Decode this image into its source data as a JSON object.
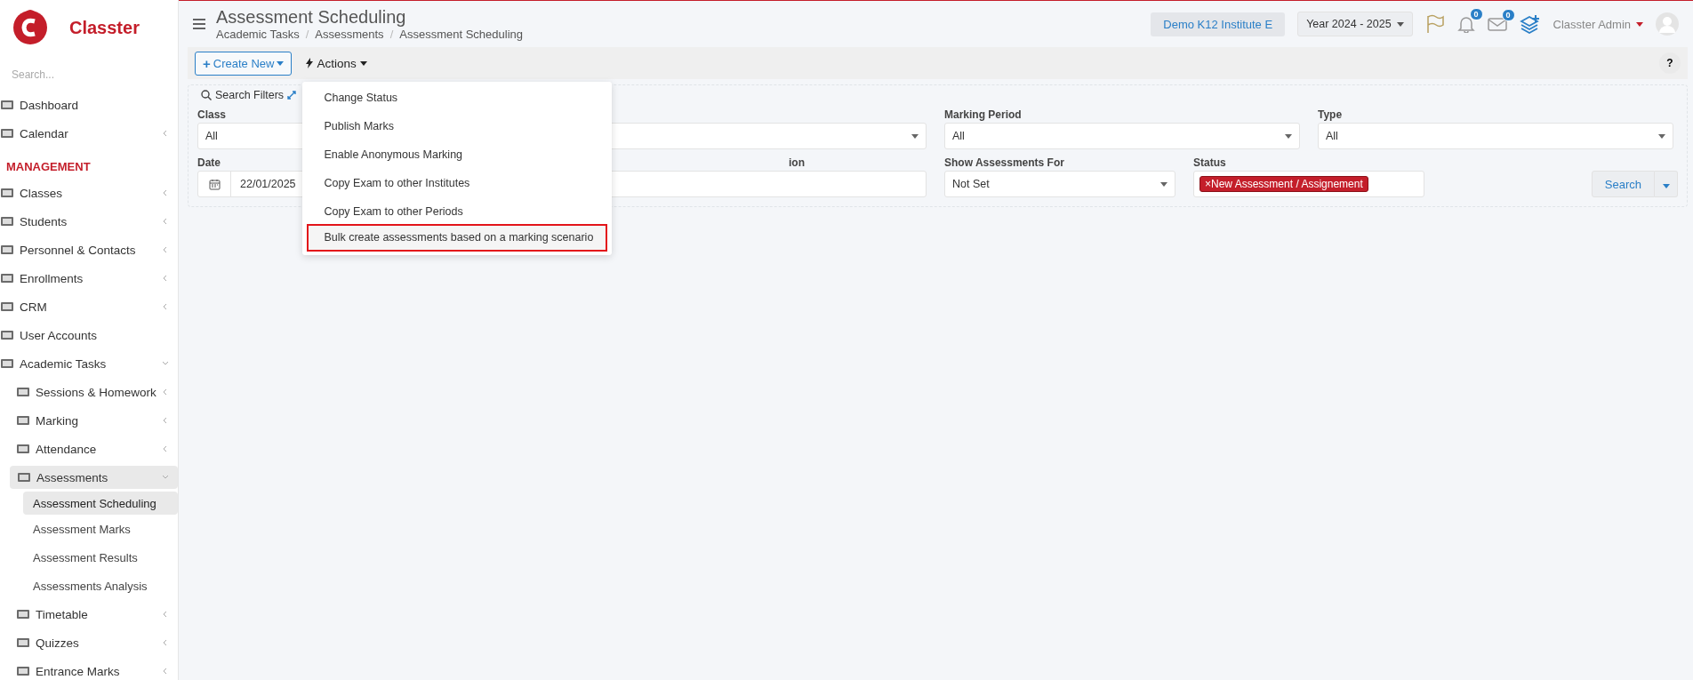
{
  "brand": {
    "name": "Classter"
  },
  "sidebar": {
    "search": {
      "placeholder": "Search..."
    },
    "items": [
      {
        "kind": "link",
        "label": "Dashboard",
        "selected": false
      },
      {
        "kind": "link",
        "label": "Calendar",
        "expanded": false,
        "selected": false
      },
      {
        "kind": "section",
        "label": "MANAGEMENT"
      },
      {
        "kind": "link",
        "label": "Classes",
        "expanded": false,
        "selected": false
      },
      {
        "kind": "link",
        "label": "Students",
        "expanded": false,
        "selected": false
      },
      {
        "kind": "link",
        "label": "Personnel & Contacts",
        "expanded": false,
        "selected": false
      },
      {
        "kind": "link",
        "label": "Enrollments",
        "expanded": false,
        "selected": false
      },
      {
        "kind": "link",
        "label": "CRM",
        "expanded": false,
        "selected": false
      },
      {
        "kind": "link",
        "label": "User Accounts",
        "selected": false
      },
      {
        "kind": "link",
        "label": "Academic Tasks",
        "expanded": true,
        "selected": false,
        "children": [
          {
            "kind": "link",
            "label": "Sessions & Homework",
            "expanded": false,
            "selected": false
          },
          {
            "kind": "link",
            "label": "Marking",
            "expanded": false,
            "selected": false
          },
          {
            "kind": "link",
            "label": "Attendance",
            "expanded": false,
            "selected": false
          },
          {
            "kind": "link",
            "label": "Assessments",
            "expanded": true,
            "selected": true,
            "children": [
              {
                "kind": "link",
                "label": "Assessment Scheduling",
                "selected": true
              },
              {
                "kind": "link",
                "label": "Assessment Marks",
                "selected": false
              },
              {
                "kind": "link",
                "label": "Assessment Results",
                "selected": false
              },
              {
                "kind": "link",
                "label": "Assessments Analysis",
                "selected": false
              }
            ]
          },
          {
            "kind": "link",
            "label": "Timetable",
            "expanded": false,
            "selected": false
          },
          {
            "kind": "link",
            "label": "Quizzes",
            "expanded": false,
            "selected": false
          },
          {
            "kind": "link",
            "label": "Entrance Marks",
            "expanded": false,
            "selected": false
          }
        ]
      }
    ]
  },
  "header": {
    "title": "Assessment Scheduling",
    "breadcrumb_separator": "/",
    "breadcrumbs": [
      "Academic Tasks",
      "Assessments",
      "Assessment Scheduling"
    ],
    "institute": "Demo K12 Institute E",
    "year": "Year 2024 - 2025",
    "notifications": "0",
    "messages": "0",
    "user": "Classter Admin"
  },
  "toolbar": {
    "create_symbol": "+",
    "create": "Create New",
    "actions": "Actions",
    "help": "?"
  },
  "actions_menu": {
    "items": [
      {
        "label": "Change Status",
        "highlighted": false
      },
      {
        "label": "Publish Marks",
        "highlighted": false
      },
      {
        "label": "Enable Anonymous Marking",
        "highlighted": false
      },
      {
        "label": "Copy Exam to other Institutes",
        "highlighted": false
      },
      {
        "label": "Copy Exam to other Periods",
        "highlighted": false
      },
      {
        "label": "Bulk create assessments based on a marking scenario",
        "highlighted": true
      }
    ]
  },
  "filters": {
    "title": "Search Filters",
    "tag_remove_symbol": "×",
    "rows": [
      [
        {
          "kind": "select",
          "label": "Class",
          "value": "All"
        },
        {
          "kind": "select"
        },
        {
          "kind": "select",
          "label": "Marking Period",
          "value": "All"
        },
        {
          "kind": "select",
          "label": "Type",
          "value": "All"
        }
      ],
      [
        {
          "kind": "date",
          "label": "Date",
          "value": "22/01/2025"
        },
        {
          "kind": "text",
          "label": "ion"
        },
        {
          "kind": "select",
          "label": "Show Assessments For",
          "value": "Not Set"
        },
        {
          "kind": "tags",
          "label": "Status",
          "tags": [
            "New Assessment / Assignement"
          ]
        }
      ]
    ],
    "search_button": "Search"
  }
}
